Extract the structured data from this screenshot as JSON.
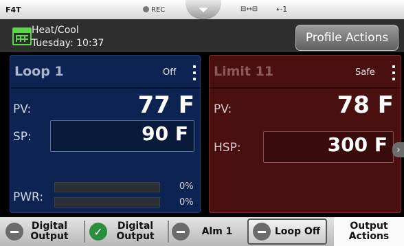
{
  "statusbar": {
    "brand": "F4T",
    "rec_label": "REC",
    "net_label": "⊟↔⊟",
    "usb_label": "⇠1"
  },
  "header": {
    "profile_name": "Heat/Cool",
    "profile_time": "Tuesday: 10:37",
    "profile_actions_label": "Profile Actions"
  },
  "loop": {
    "title": "Loop 1",
    "state": "Off",
    "pv_label": "PV:",
    "pv_value": "77 F",
    "sp_label": "SP:",
    "sp_value": "90 F",
    "pwr_label": "PWR:",
    "pwr_values": [
      "0%",
      "0%"
    ],
    "pwr_fractions": [
      0,
      0
    ]
  },
  "limit": {
    "title": "Limit 11",
    "state": "Safe",
    "pv_label": "PV:",
    "pv_value": "78 F",
    "hsp_label": "HSP:",
    "hsp_value": "300 F"
  },
  "bottom": {
    "digital_output_1": "Digital Output",
    "digital_output_2": "Digital Output",
    "alarm_label": "Alm 1",
    "loop_off_label": "Loop Off",
    "output_actions_label": "Output Actions"
  },
  "colors": {
    "loop_panel": "#0d2452",
    "limit_panel": "#4a1010",
    "calendar_green": "#5dd84a",
    "ok_green": "#2a8f3a"
  },
  "icons": {
    "calendar": "calendar-icon",
    "menu": "more-vert-icon",
    "next": "chevron-right-icon",
    "status_off": "minus-circle-icon",
    "status_ok": "check-circle-icon"
  }
}
